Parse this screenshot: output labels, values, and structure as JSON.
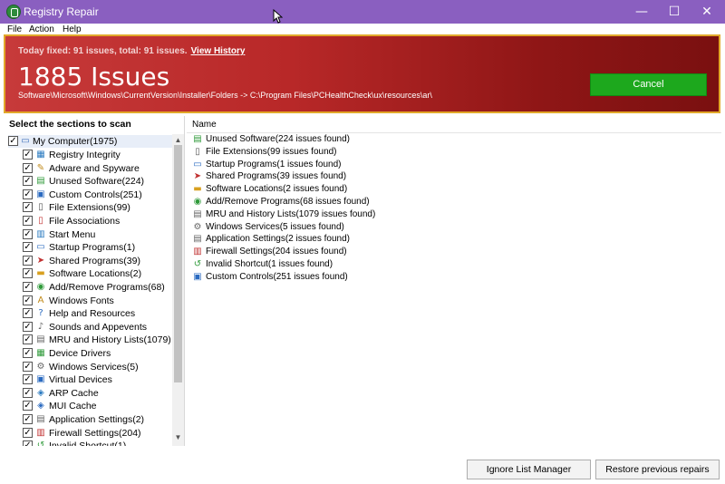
{
  "window": {
    "title": "Registry Repair",
    "minimize": "—",
    "maximize": "☐",
    "close": "✕"
  },
  "menu": {
    "items": [
      "File",
      "Action",
      "Help"
    ]
  },
  "banner": {
    "fixed_text": "Today fixed: 91 issues, total: 91 issues.",
    "view_history": "View History",
    "issues_count": "1885 Issues",
    "current_path": "Software\\Microsoft\\Windows\\CurrentVersion\\Installer\\Folders -> C:\\Program Files\\PCHealthCheck\\ux\\resources\\ar\\",
    "cancel_label": "Cancel",
    "colors": {
      "banner": "#b82828",
      "border": "#e1a82a",
      "cancel": "#1da81d"
    }
  },
  "sections": {
    "header": "Select the sections to scan",
    "root": {
      "label": "My Computer(1975)",
      "icon": "computer-icon",
      "checked": true
    },
    "items": [
      {
        "label": "Registry Integrity",
        "icon": "registry-icon",
        "checked": true
      },
      {
        "label": "Adware and Spyware",
        "icon": "adware-icon",
        "checked": true
      },
      {
        "label": "Unused Software(224)",
        "icon": "software-icon",
        "checked": true
      },
      {
        "label": "Custom Controls(251)",
        "icon": "controls-icon",
        "checked": true
      },
      {
        "label": "File Extensions(99)",
        "icon": "file-icon",
        "checked": true
      },
      {
        "label": "File Associations",
        "icon": "file-assoc-icon",
        "checked": true
      },
      {
        "label": "Start Menu",
        "icon": "start-menu-icon",
        "checked": true
      },
      {
        "label": "Startup Programs(1)",
        "icon": "startup-icon",
        "checked": true
      },
      {
        "label": "Shared Programs(39)",
        "icon": "shared-icon",
        "checked": true
      },
      {
        "label": "Software Locations(2)",
        "icon": "folder-icon",
        "checked": true
      },
      {
        "label": "Add/Remove Programs(68)",
        "icon": "add-remove-icon",
        "checked": true
      },
      {
        "label": "Windows Fonts",
        "icon": "font-icon",
        "checked": true
      },
      {
        "label": "Help and Resources",
        "icon": "help-icon",
        "checked": true
      },
      {
        "label": "Sounds and Appevents",
        "icon": "sound-icon",
        "checked": true
      },
      {
        "label": "MRU and History Lists(1079)",
        "icon": "history-icon",
        "checked": true
      },
      {
        "label": "Device Drivers",
        "icon": "driver-icon",
        "checked": true
      },
      {
        "label": "Windows Services(5)",
        "icon": "services-icon",
        "checked": true
      },
      {
        "label": "Virtual Devices",
        "icon": "virtual-device-icon",
        "checked": true
      },
      {
        "label": "ARP Cache",
        "icon": "arp-icon",
        "checked": true
      },
      {
        "label": "MUI Cache",
        "icon": "mui-icon",
        "checked": true
      },
      {
        "label": "Application Settings(2)",
        "icon": "app-settings-icon",
        "checked": true
      },
      {
        "label": "Firewall Settings(204)",
        "icon": "firewall-icon",
        "checked": true
      },
      {
        "label": "Invalid Shortcut(1)",
        "icon": "shortcut-icon",
        "checked": true
      }
    ]
  },
  "results": {
    "column_name": "Name",
    "items": [
      {
        "label": "Unused Software(224 issues found)",
        "icon": "software-icon"
      },
      {
        "label": "File Extensions(99 issues found)",
        "icon": "file-icon"
      },
      {
        "label": "Startup Programs(1 issues found)",
        "icon": "startup-icon"
      },
      {
        "label": "Shared Programs(39 issues found)",
        "icon": "shared-icon"
      },
      {
        "label": "Software Locations(2 issues found)",
        "icon": "folder-icon"
      },
      {
        "label": "Add/Remove Programs(68 issues found)",
        "icon": "add-remove-icon"
      },
      {
        "label": "MRU and History Lists(1079 issues found)",
        "icon": "history-icon"
      },
      {
        "label": "Windows Services(5 issues found)",
        "icon": "services-icon"
      },
      {
        "label": "Application Settings(2 issues found)",
        "icon": "app-settings-icon"
      },
      {
        "label": "Firewall Settings(204 issues found)",
        "icon": "firewall-icon"
      },
      {
        "label": "Invalid Shortcut(1 issues found)",
        "icon": "shortcut-icon"
      },
      {
        "label": "Custom Controls(251 issues found)",
        "icon": "controls-icon"
      }
    ]
  },
  "buttons": {
    "ignore_list": "Ignore List Manager",
    "restore": "Restore previous repairs"
  }
}
